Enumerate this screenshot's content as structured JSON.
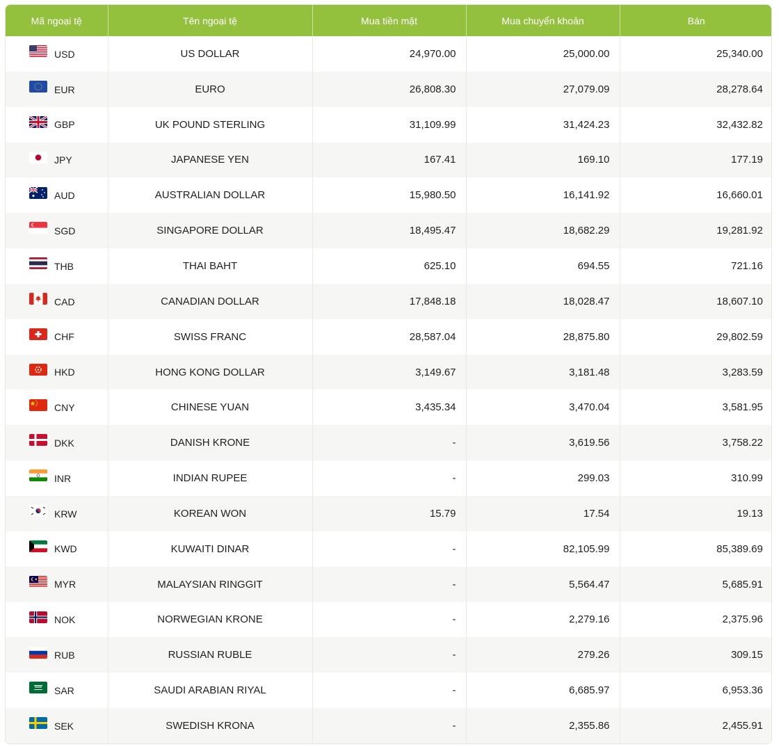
{
  "table": {
    "headers": [
      "Mã ngoại tệ",
      "Tên ngoại tệ",
      "Mua tiền mặt",
      "Mua chuyển khoản",
      "Bán"
    ],
    "rows": [
      {
        "code": "USD",
        "name": "US DOLLAR",
        "cash": "24,970.00",
        "transfer": "25,000.00",
        "sell": "25,340.00",
        "flag_icon": "us-flag-icon"
      },
      {
        "code": "EUR",
        "name": "EURO",
        "cash": "26,808.30",
        "transfer": "27,079.09",
        "sell": "28,278.64",
        "flag_icon": "eu-flag-icon"
      },
      {
        "code": "GBP",
        "name": "UK POUND STERLING",
        "cash": "31,109.99",
        "transfer": "31,424.23",
        "sell": "32,432.82",
        "flag_icon": "uk-flag-icon"
      },
      {
        "code": "JPY",
        "name": "JAPANESE YEN",
        "cash": "167.41",
        "transfer": "169.10",
        "sell": "177.19",
        "flag_icon": "japan-flag-icon"
      },
      {
        "code": "AUD",
        "name": "AUSTRALIAN DOLLAR",
        "cash": "15,980.50",
        "transfer": "16,141.92",
        "sell": "16,660.01",
        "flag_icon": "australia-flag-icon"
      },
      {
        "code": "SGD",
        "name": "SINGAPORE DOLLAR",
        "cash": "18,495.47",
        "transfer": "18,682.29",
        "sell": "19,281.92",
        "flag_icon": "singapore-flag-icon"
      },
      {
        "code": "THB",
        "name": "THAI BAHT",
        "cash": "625.10",
        "transfer": "694.55",
        "sell": "721.16",
        "flag_icon": "thailand-flag-icon"
      },
      {
        "code": "CAD",
        "name": "CANADIAN DOLLAR",
        "cash": "17,848.18",
        "transfer": "18,028.47",
        "sell": "18,607.10",
        "flag_icon": "canada-flag-icon"
      },
      {
        "code": "CHF",
        "name": "SWISS FRANC",
        "cash": "28,587.04",
        "transfer": "28,875.80",
        "sell": "29,802.59",
        "flag_icon": "switzerland-flag-icon"
      },
      {
        "code": "HKD",
        "name": "HONG KONG DOLLAR",
        "cash": "3,149.67",
        "transfer": "3,181.48",
        "sell": "3,283.59",
        "flag_icon": "hong-kong-flag-icon"
      },
      {
        "code": "CNY",
        "name": "CHINESE YUAN",
        "cash": "3,435.34",
        "transfer": "3,470.04",
        "sell": "3,581.95",
        "flag_icon": "china-flag-icon"
      },
      {
        "code": "DKK",
        "name": "DANISH KRONE",
        "cash": "-",
        "transfer": "3,619.56",
        "sell": "3,758.22",
        "flag_icon": "denmark-flag-icon"
      },
      {
        "code": "INR",
        "name": "INDIAN RUPEE",
        "cash": "-",
        "transfer": "299.03",
        "sell": "310.99",
        "flag_icon": "india-flag-icon"
      },
      {
        "code": "KRW",
        "name": "KOREAN WON",
        "cash": "15.79",
        "transfer": "17.54",
        "sell": "19.13",
        "flag_icon": "south-korea-flag-icon"
      },
      {
        "code": "KWD",
        "name": "KUWAITI DINAR",
        "cash": "-",
        "transfer": "82,105.99",
        "sell": "85,389.69",
        "flag_icon": "kuwait-flag-icon"
      },
      {
        "code": "MYR",
        "name": "MALAYSIAN RINGGIT",
        "cash": "-",
        "transfer": "5,564.47",
        "sell": "5,685.91",
        "flag_icon": "malaysia-flag-icon"
      },
      {
        "code": "NOK",
        "name": "NORWEGIAN KRONE",
        "cash": "-",
        "transfer": "2,279.16",
        "sell": "2,375.96",
        "flag_icon": "norway-flag-icon"
      },
      {
        "code": "RUB",
        "name": "RUSSIAN RUBLE",
        "cash": "-",
        "transfer": "279.26",
        "sell": "309.15",
        "flag_icon": "russia-flag-icon"
      },
      {
        "code": "SAR",
        "name": "SAUDI ARABIAN RIYAL",
        "cash": "-",
        "transfer": "6,685.97",
        "sell": "6,953.36",
        "flag_icon": "saudi-arabia-flag-icon"
      },
      {
        "code": "SEK",
        "name": "SWEDISH KRONA",
        "cash": "-",
        "transfer": "2,355.86",
        "sell": "2,455.91",
        "flag_icon": "sweden-flag-icon"
      }
    ]
  },
  "colors": {
    "header_bg": "#93c13d",
    "header_text": "#ffffff",
    "row_alt_bg": "#f6f7f4"
  }
}
